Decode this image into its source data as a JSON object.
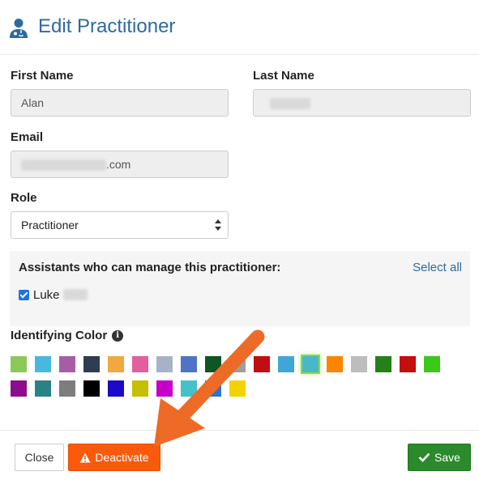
{
  "header": {
    "title": "Edit Practitioner",
    "icon": "doctor-user-icon"
  },
  "form": {
    "first_name": {
      "label": "First Name",
      "value": "Alan"
    },
    "last_name": {
      "label": "Last Name",
      "value": ""
    },
    "email": {
      "label": "Email",
      "value_suffix": ".com"
    },
    "role": {
      "label": "Role",
      "selected": "Practitioner"
    }
  },
  "assistants": {
    "title": "Assistants who can manage this practitioner:",
    "select_all": "Select all",
    "items": [
      {
        "label": "Luke",
        "checked": true
      }
    ]
  },
  "identifying_color": {
    "label": "Identifying Color",
    "swatches_row1": [
      "#8dc85a",
      "#47b9de",
      "#a55ea3",
      "#2e3e50",
      "#f0a940",
      "#e35e9c",
      "#a6b3c7",
      "#4f74c6",
      "#0f5525",
      "#9e9e9e",
      "#c10e13",
      "#3fa7d6",
      "#48b8c8",
      "#fd8400",
      "#bdbdbd",
      "#268018",
      "#c20f10",
      "#3cc71b"
    ],
    "swatches_row2": [
      "#8d0e8c",
      "#2a8282",
      "#7d7d7d",
      "#000000",
      "#1b0ac8",
      "#c8be00",
      "#c600c8",
      "#45c2c8",
      "#2f74c8",
      "#f2d300"
    ],
    "selected_index": 12
  },
  "footer": {
    "close": "Close",
    "deactivate": "Deactivate",
    "save": "Save"
  },
  "colors": {
    "accent": "#2d6aa0",
    "deactivate": "#fb5a0a",
    "save": "#2b8a2b",
    "annotation_arrow": "#ee6a27"
  }
}
